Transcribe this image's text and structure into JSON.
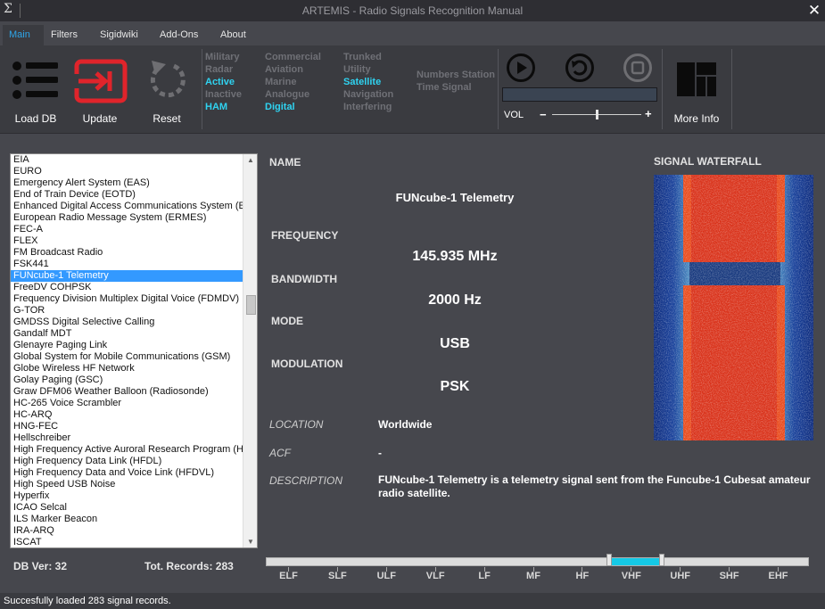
{
  "window": {
    "app_icon": "Σ",
    "title": "ARTEMIS - Radio Signals Recognition Manual",
    "close_glyph": "✕"
  },
  "menu": {
    "tabs": [
      {
        "label": "Main",
        "active": true
      },
      {
        "label": "Filters",
        "active": false
      },
      {
        "label": "Sigidwiki",
        "active": false
      },
      {
        "label": "Add-Ons",
        "active": false
      },
      {
        "label": "About",
        "active": false
      }
    ]
  },
  "ribbon": {
    "load_db_label": "Load DB",
    "update_label": "Update",
    "reset_label": "Reset",
    "more_info_label": "More Info",
    "vol_label": "VOL",
    "vol_minus": "−",
    "vol_plus": "+",
    "volume_level": 0.5,
    "filters": {
      "col1": [
        {
          "label": "Military",
          "on": false
        },
        {
          "label": "Radar",
          "on": false
        },
        {
          "label": "Active",
          "on": true
        },
        {
          "label": "Inactive",
          "on": false
        },
        {
          "label": "HAM",
          "on": true
        }
      ],
      "col2": [
        {
          "label": "Commercial",
          "on": false
        },
        {
          "label": "Aviation",
          "on": false
        },
        {
          "label": "Marine",
          "on": false
        },
        {
          "label": "Analogue",
          "on": false
        },
        {
          "label": "Digital",
          "on": true
        }
      ],
      "col3": [
        {
          "label": "Trunked",
          "on": false
        },
        {
          "label": "Utility",
          "on": false
        },
        {
          "label": "Satellite",
          "on": true
        },
        {
          "label": "Navigation",
          "on": false
        },
        {
          "label": "Interfering",
          "on": false
        }
      ],
      "col4": [
        {
          "label": "Numbers Station",
          "on": false
        },
        {
          "label": "Time Signal",
          "on": false
        }
      ]
    },
    "accent_red": "#e0242b",
    "accent_cyan": "#2fd3f1"
  },
  "signal_list": {
    "items": [
      "EIA",
      "EURO",
      "Emergency Alert System (EAS)",
      "End of Train Device (EOTD)",
      "Enhanced Digital Access Communications System (EDACS)",
      "European Radio Message System (ERMES)",
      "FEC-A",
      "FLEX",
      "FM Broadcast Radio",
      "FSK441",
      "FUNcube-1 Telemetry",
      "FreeDV COHPSK",
      "Frequency Division Multiplex Digital Voice (FDMDV)",
      "G-TOR",
      "GMDSS Digital Selective Calling",
      "Gandalf MDT",
      "Glenayre Paging Link",
      "Global System for Mobile Communications (GSM)",
      "Globe Wireless HF Network",
      "Golay Paging (GSC)",
      "Graw DFM06 Weather Balloon (Radiosonde)",
      "HC-265 Voice Scrambler",
      "HC-ARQ",
      "HNG-FEC",
      "Hellschreiber",
      "High Frequency Active Auroral Research Program (HAARP)",
      "High Frequency Data Link (HFDL)",
      "High Frequency Data and Voice Link (HFDVL)",
      "High Speed USB Noise",
      "Hyperfix",
      "ICAO Selcal",
      "ILS Marker Beacon",
      "IRA-ARQ",
      "ISCAT"
    ],
    "selected_index": 10,
    "db_version": "DB Ver: 32",
    "total_records": "Tot. Records: 283"
  },
  "details": {
    "name_header": "NAME",
    "name": "FUNcube-1 Telemetry",
    "frequency_header": "FREQUENCY",
    "frequency": "145.935  MHz",
    "bandwidth_header": "BANDWIDTH",
    "bandwidth": "2000  Hz",
    "mode_header": "MODE",
    "mode": "USB",
    "modulation_header": "MODULATION",
    "modulation": "PSK",
    "location_label": "LOCATION",
    "location": "Worldwide",
    "acf_label": "ACF",
    "acf": "-",
    "description_label": "DESCRIPTION",
    "description": "FUNcube-1 Telemetry is a telemetry signal sent from the Funcube-1 Cubesat amateur radio satellite.",
    "waterfall_header": "SIGNAL WATERFALL"
  },
  "bands": {
    "labels": [
      "ELF",
      "SLF",
      "ULF",
      "VLF",
      "LF",
      "MF",
      "HF",
      "VHF",
      "UHF",
      "SHF",
      "EHF"
    ],
    "selected": "VHF"
  },
  "status": {
    "text": "Succesfully loaded 283 signal records."
  }
}
